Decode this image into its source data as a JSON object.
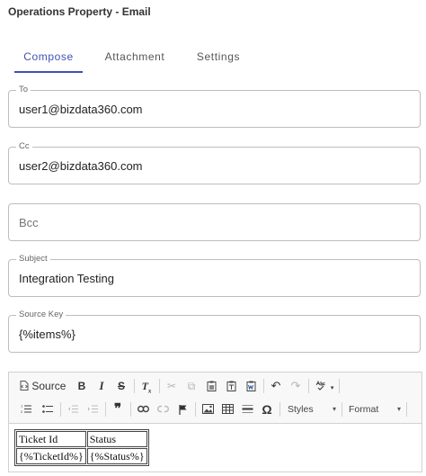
{
  "page": {
    "title": "Operations Property - Email"
  },
  "tabs": [
    {
      "label": "Compose",
      "active": true
    },
    {
      "label": "Attachment",
      "active": false
    },
    {
      "label": "Settings",
      "active": false
    }
  ],
  "fields": {
    "to": {
      "label": "To",
      "value": "user1@bizdata360.com"
    },
    "cc": {
      "label": "Cc",
      "value": "user2@bizdata360.com"
    },
    "bcc": {
      "label": "",
      "placeholder": "Bcc",
      "value": ""
    },
    "subject": {
      "label": "Subject",
      "value": "Integration Testing"
    },
    "source_key": {
      "label": "Source Key",
      "value": "{%items%}"
    }
  },
  "editor": {
    "toolbar": {
      "source_label": "Source",
      "styles_label": "Styles",
      "format_label": "Format",
      "icons": [
        "source-icon",
        "bold-icon",
        "italic-icon",
        "strikethrough-icon",
        "remove-format-icon",
        "cut-icon",
        "copy-icon",
        "paste-icon",
        "paste-text-icon",
        "paste-word-icon",
        "undo-icon",
        "redo-icon",
        "spellcheck-icon",
        "numbered-list-icon",
        "bulleted-list-icon",
        "outdent-icon",
        "indent-icon",
        "blockquote-icon",
        "link-icon",
        "unlink-icon",
        "anchor-icon",
        "image-icon",
        "table-icon",
        "horizontal-line-icon",
        "special-char-icon"
      ]
    },
    "table": {
      "headers": [
        "Ticket Id",
        "Status"
      ],
      "rows": [
        [
          "{%TicketId%}",
          "{%Status%}"
        ]
      ]
    }
  },
  "colors": {
    "accent": "#3f51b5",
    "border": "#bdbdbd",
    "toolbar_bg": "#f8f8f8"
  }
}
